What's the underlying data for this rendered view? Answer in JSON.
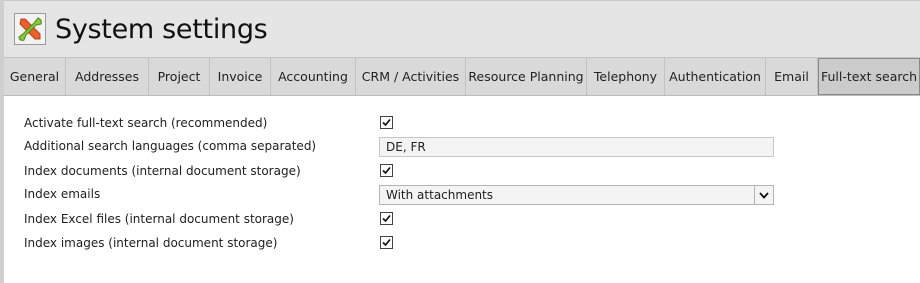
{
  "header": {
    "title": "System settings",
    "icon": "tools-icon"
  },
  "tabs": [
    {
      "label": "General",
      "active": false
    },
    {
      "label": "Addresses",
      "active": false
    },
    {
      "label": "Project",
      "active": false
    },
    {
      "label": "Invoice",
      "active": false
    },
    {
      "label": "Accounting",
      "active": false
    },
    {
      "label": "CRM / Activities",
      "active": false
    },
    {
      "label": "Resource Planning",
      "active": false
    },
    {
      "label": "Telephony",
      "active": false
    },
    {
      "label": "Authentication",
      "active": false
    },
    {
      "label": "Email",
      "active": false
    },
    {
      "label": "Full-text search",
      "active": true
    }
  ],
  "settings": {
    "activate": {
      "label": "Activate full-text search (recommended)",
      "checked": true
    },
    "languages": {
      "label": "Additional search languages (comma separated)",
      "value": "DE, FR"
    },
    "documents": {
      "label": "Index documents (internal document storage)",
      "checked": true
    },
    "emails": {
      "label": "Index emails",
      "selected": "With attachments"
    },
    "excel": {
      "label": "Index Excel files (internal document storage)",
      "checked": true
    },
    "images": {
      "label": "Index images (internal document storage)",
      "checked": true
    }
  }
}
